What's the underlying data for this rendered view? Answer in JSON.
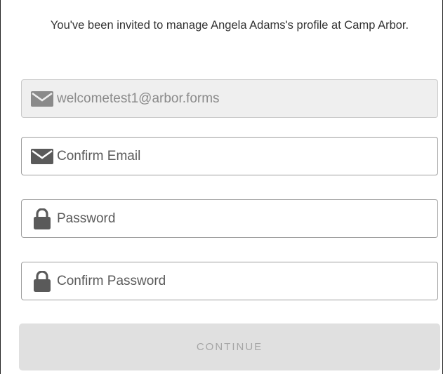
{
  "intro": {
    "text": "You've been invited to manage Angela Adams's profile at Camp Arbor."
  },
  "form": {
    "email": {
      "value": "welcometest1@arbor.forms",
      "icon": "envelope-icon"
    },
    "confirm_email": {
      "placeholder": "Confirm Email",
      "icon": "envelope-icon"
    },
    "password": {
      "placeholder": "Password",
      "icon": "lock-icon"
    },
    "confirm_password": {
      "placeholder": "Confirm Password",
      "icon": "lock-icon"
    }
  },
  "continue_button": {
    "label": "CONTINUE"
  },
  "colors": {
    "icon": "#5a5a5a",
    "icon_disabled": "#8a8a8a",
    "button_bg": "#e0e0e0",
    "button_text": "#a6a6a6",
    "field_border": "#9e9e9e",
    "disabled_bg": "#efefef"
  }
}
